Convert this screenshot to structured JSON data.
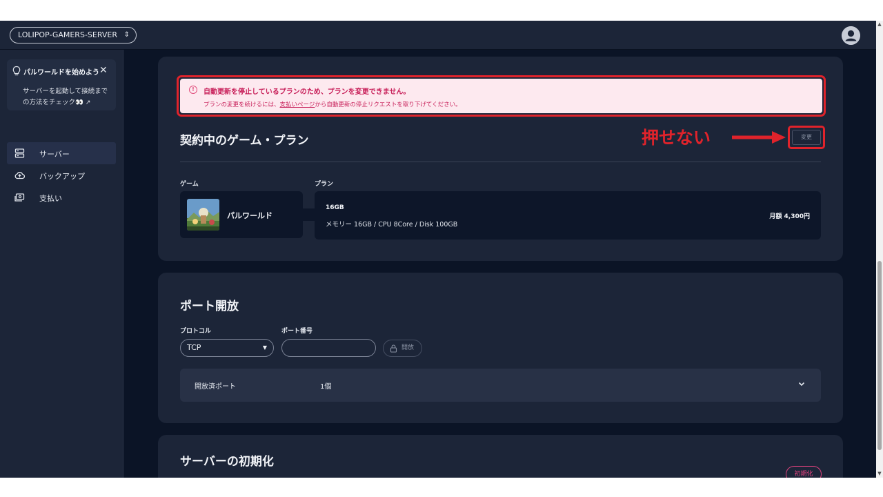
{
  "header": {
    "server_name": "LOLIPOP-GAMERS-SERVER",
    "server_select_icon": "updown-arrows-icon",
    "avatar_icon": "user-avatar-icon"
  },
  "sidebar": {
    "tip": {
      "title": "パルワールドを始めよう",
      "text": "サーバーを起動して接続までの方法をチェック👀",
      "icons": [
        "lightbulb-icon",
        "close-icon",
        "external-link-icon"
      ]
    },
    "items": [
      {
        "label": "サーバー",
        "icon": "server-icon",
        "active": true
      },
      {
        "label": "バックアップ",
        "icon": "cloud-upload-icon",
        "active": false
      },
      {
        "label": "支払い",
        "icon": "payment-icon",
        "active": false
      }
    ]
  },
  "alert": {
    "title": "自動更新を停止しているプランのため、プランを変更できません。",
    "desc_before": "プランの変更を続けるには、",
    "desc_link": "支払いページ",
    "desc_after": "から自動更新の停止リクエストを取り下げてください。",
    "icon": "alert-circle-icon",
    "color": "#c8205a"
  },
  "plan_section": {
    "title": "契約中のゲーム・プラン",
    "annotation": "押せない",
    "change_label": "変更",
    "game_label": "ゲーム",
    "plan_label": "プラン",
    "game_name": "パルワールド",
    "plan_name": "16GB",
    "plan_spec": "メモリー 16GB / CPU 8Core / Disk 100GB",
    "plan_price": "月額 4,300円"
  },
  "port_section": {
    "title": "ポート開放",
    "protocol_label": "プロトコル",
    "protocol_value": "TCP",
    "port_label": "ポート番号",
    "port_value": "",
    "open_label": "開放",
    "opened_label": "開放済ポート",
    "opened_count": "1個"
  },
  "init_section": {
    "title": "サーバーの初期化",
    "button_label": "初期化"
  },
  "colors": {
    "background": "#0b1426",
    "card": "#1c2538",
    "alert_bg": "#fde9ef",
    "annotation_red": "#e0232b",
    "danger": "#e0427e"
  }
}
